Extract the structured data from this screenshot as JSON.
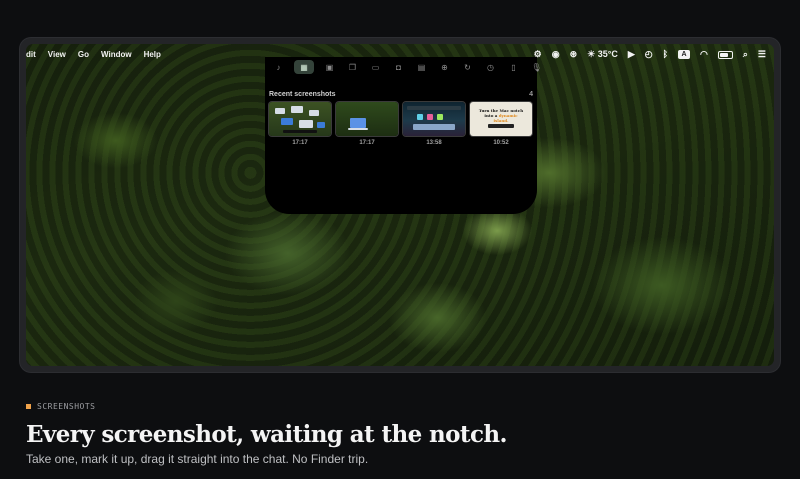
{
  "menubar": {
    "left": [
      "dit",
      "View",
      "Go",
      "Window",
      "Help"
    ],
    "temperature": "35°C",
    "input_source": "A"
  },
  "notch": {
    "tabs": [
      {
        "icon": "music-note-icon",
        "glyph": "♪"
      },
      {
        "icon": "screenshots-icon",
        "glyph": "▦",
        "active": true
      },
      {
        "icon": "clipboard-icon",
        "glyph": "▣"
      },
      {
        "icon": "files-icon",
        "glyph": "❐"
      },
      {
        "icon": "image-icon",
        "glyph": "▭"
      },
      {
        "icon": "camera-icon",
        "glyph": "◘"
      },
      {
        "icon": "calendar-icon",
        "glyph": "▤"
      },
      {
        "icon": "download-icon",
        "glyph": "⊕"
      },
      {
        "icon": "sync-icon",
        "glyph": "↻"
      },
      {
        "icon": "clock-icon",
        "glyph": "◷"
      },
      {
        "icon": "notes-icon",
        "glyph": "▯"
      },
      {
        "icon": "microphone-icon",
        "glyph": "🎙"
      }
    ],
    "section_title": "Recent screenshots",
    "count": "4",
    "screenshots": [
      {
        "time": "17:17"
      },
      {
        "time": "17:17"
      },
      {
        "time": "13:58"
      },
      {
        "time": "10:52",
        "headline_a": "Turn the Mac notch",
        "headline_b": "into a ",
        "headline_c": "dynamic island."
      }
    ]
  },
  "caption": {
    "eyebrow": "SCREENSHOTS",
    "headline": "Every screenshot, waiting at the notch.",
    "subline": "Take one, mark it up, drag it straight into the chat. No Finder trip."
  },
  "colors": {
    "accent": "#f0a24a",
    "background": "#0d0e10"
  }
}
